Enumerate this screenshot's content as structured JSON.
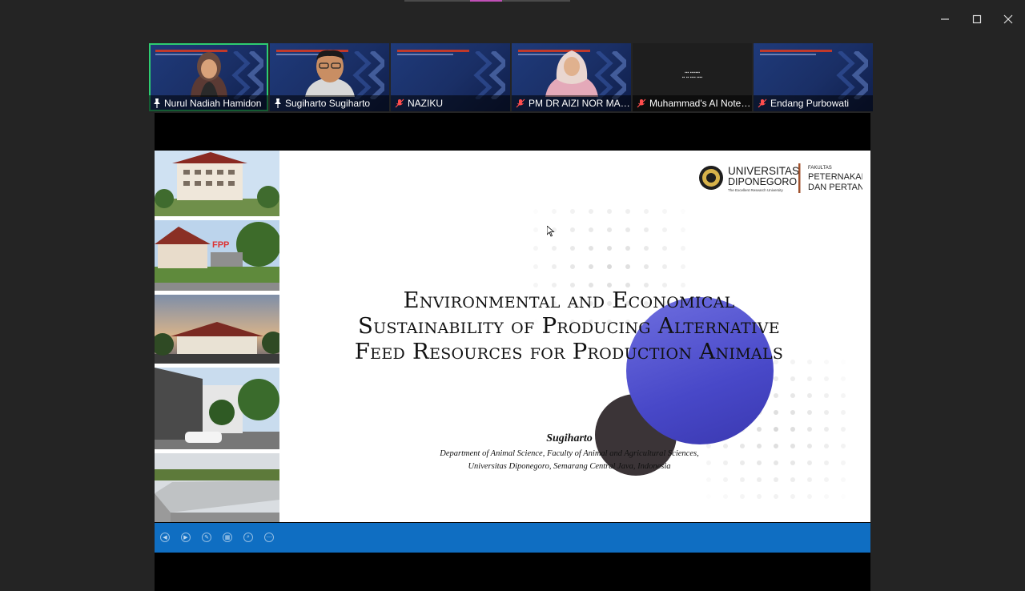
{
  "window_controls": {
    "minimize": "minimize-icon",
    "maximize": "maximize-icon",
    "close": "close-icon"
  },
  "participants": [
    {
      "name": "Nurul Nadiah Hamidon",
      "status_icon": "pin-icon",
      "active_speaker": true
    },
    {
      "name": "Sugiharto Sugiharto",
      "status_icon": "pin-icon",
      "active_speaker": false
    },
    {
      "name": "NAZIKU",
      "status_icon": "mic-muted-icon",
      "active_speaker": false
    },
    {
      "name": "PM DR AIZI NOR MAZIL...",
      "status_icon": "mic-muted-icon",
      "active_speaker": false
    },
    {
      "name": "Muhammad's AI Noteta...",
      "status_icon": "mic-muted-icon",
      "active_speaker": false
    },
    {
      "name": "Endang Purbowati",
      "status_icon": "mic-muted-icon",
      "active_speaker": false
    }
  ],
  "slide": {
    "logo": {
      "university_line1": "UNIVERSITAS",
      "university_line2": "DIPONEGORO",
      "tagline": "The Excellent Research University",
      "faculty_small": "FAKULTAS",
      "faculty_line1": "PETERNAKAN",
      "faculty_line2": "DAN PERTANIAN"
    },
    "title": "Environmental and Economical Sustainability of Producing Alternative Feed Resources for Production Animals",
    "author": "Sugiharto",
    "affiliation_line1": "Department of Animal Science, Faculty of Animal and Agricultural Sciences,",
    "affiliation_line2": "Universitas Diponegoro, Semarang Central Java, Indonesia",
    "photo_sign_text": "FPP"
  },
  "colors": {
    "active_speaker_border": "#2ecc71",
    "slide_control_bar": "#0f6ec2",
    "accent_circle": "#4848c8"
  },
  "slide_controls": [
    "previous-icon",
    "next-icon",
    "pen-icon",
    "slides-icon",
    "zoom-icon",
    "more-icon"
  ]
}
